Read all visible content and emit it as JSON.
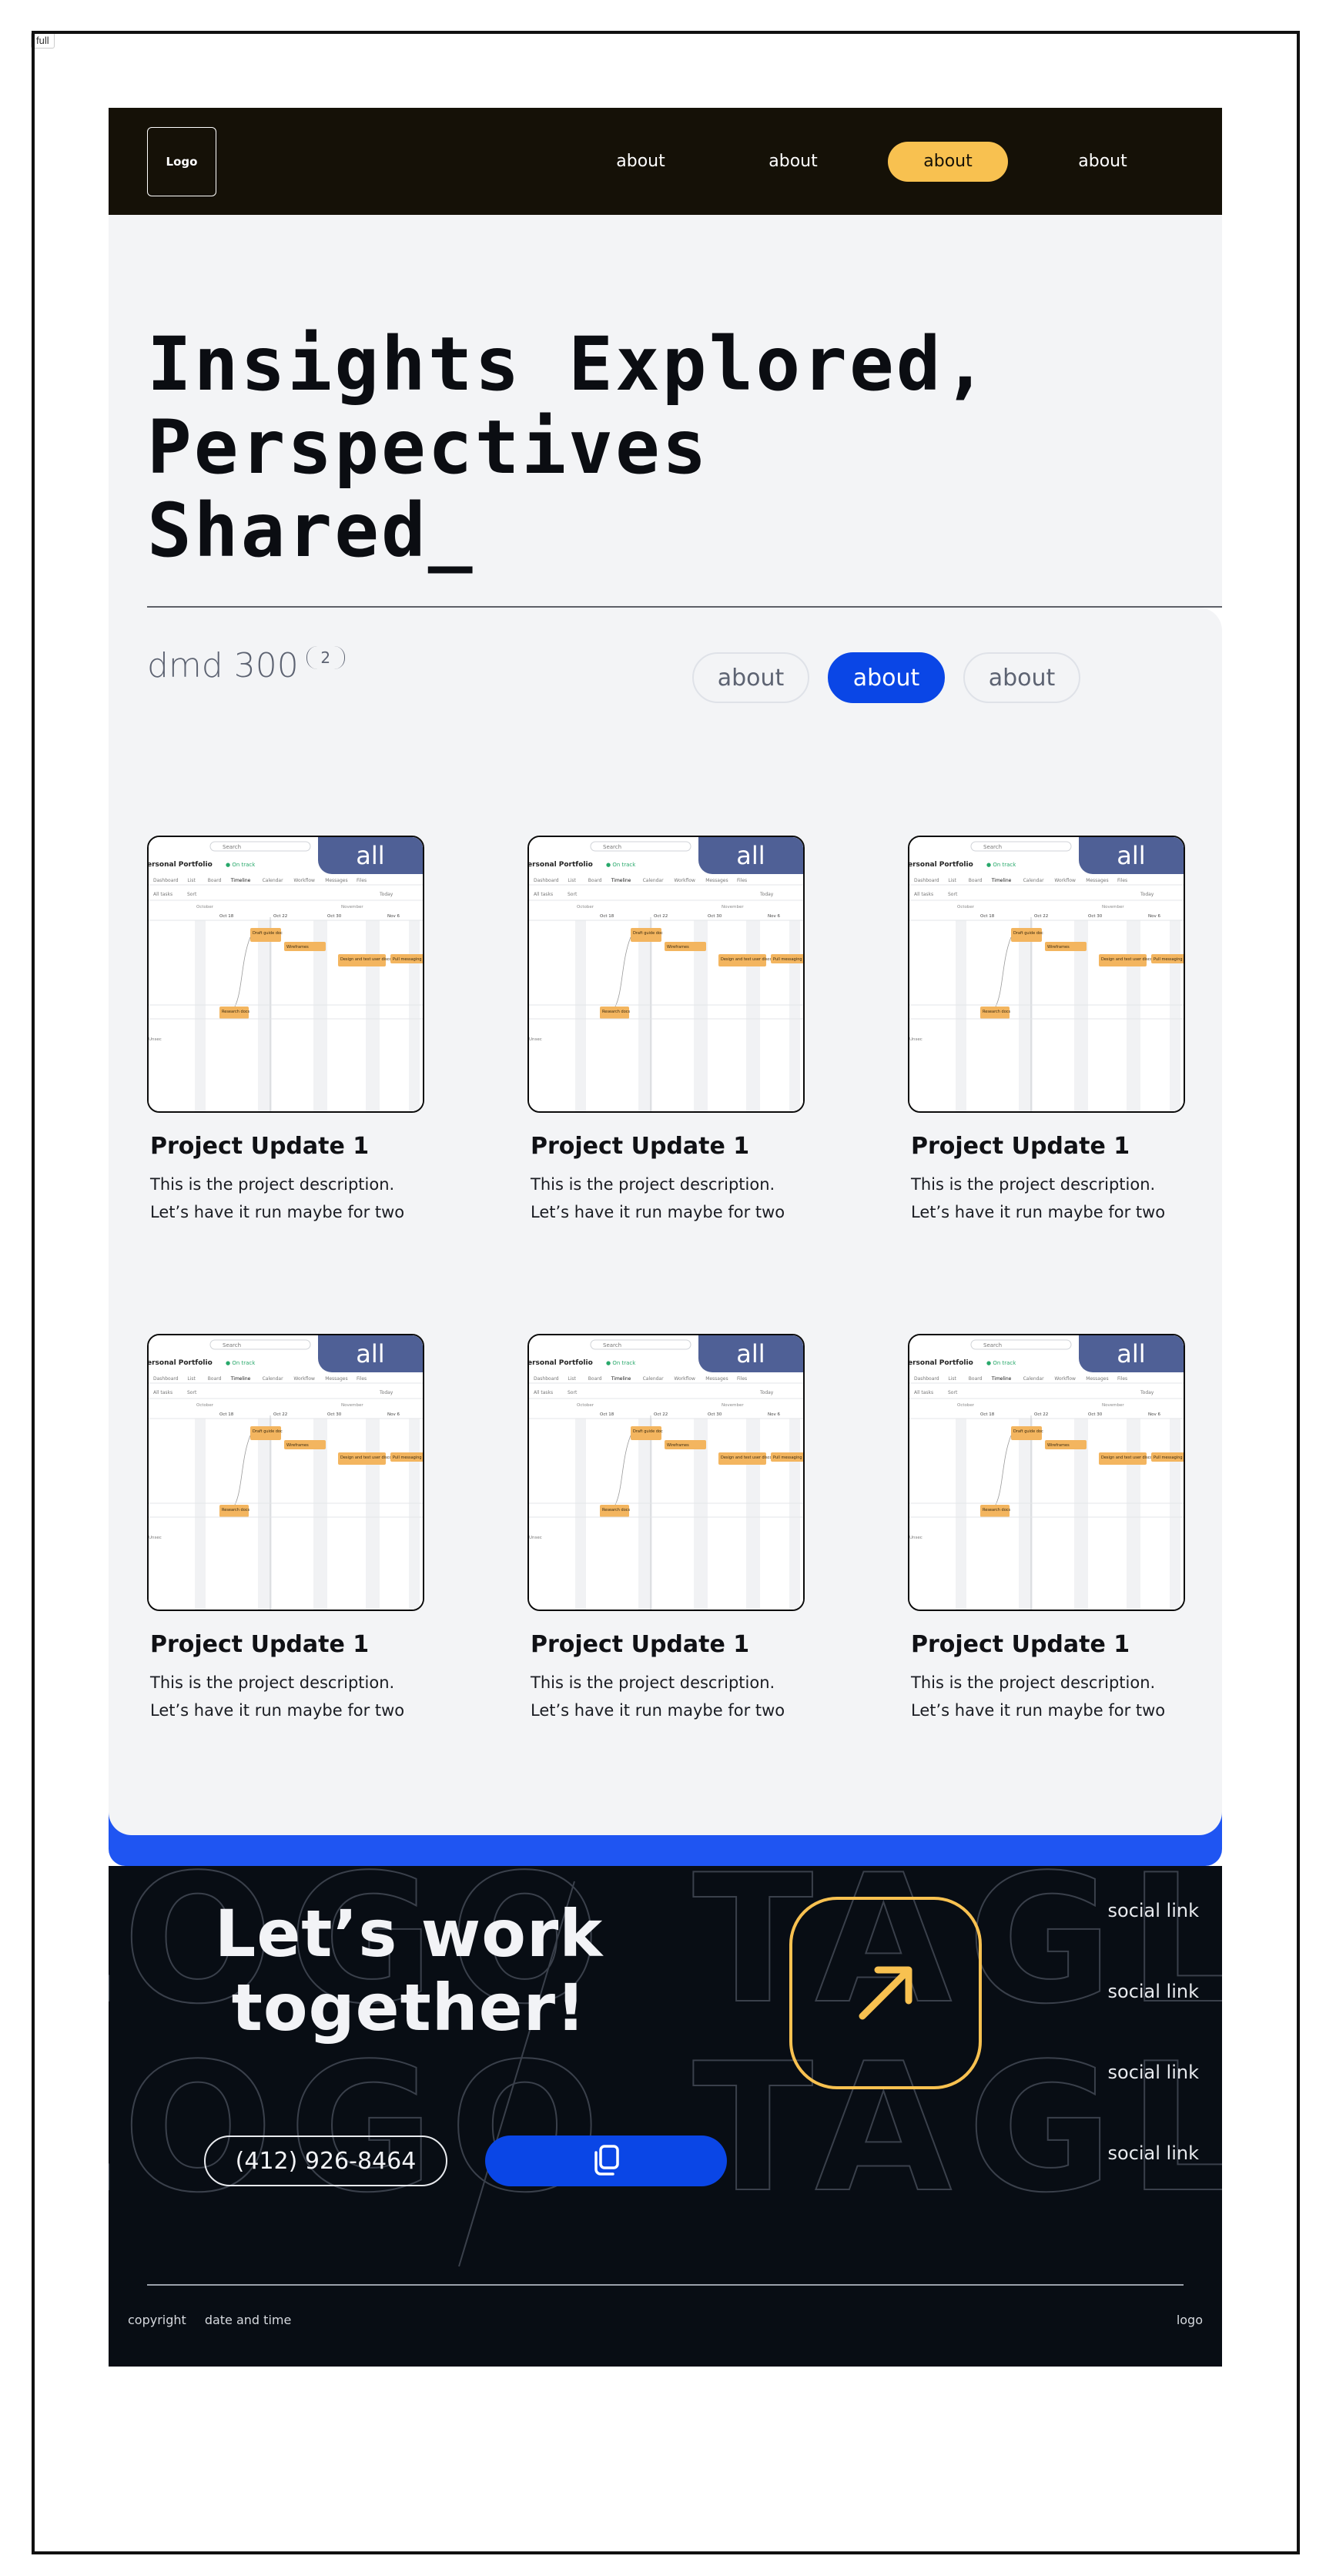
{
  "frame": {
    "label": "full"
  },
  "header": {
    "logo": "Logo",
    "nav": [
      {
        "label": "about",
        "active": false
      },
      {
        "label": "about",
        "active": false
      },
      {
        "label": "about",
        "active": true
      },
      {
        "label": "about",
        "active": false
      }
    ]
  },
  "hero": {
    "title": "Insights Explored,\nPerspectives\nShared_"
  },
  "projects": {
    "title": "dmd 300",
    "count": "2",
    "filters": [
      {
        "label": "about",
        "active": false
      },
      {
        "label": "about",
        "active": true
      },
      {
        "label": "about",
        "active": false
      }
    ],
    "cards": [
      {
        "badge": "all",
        "title": "Project Update 1",
        "description": "This is the project description. Let’s have it run maybe for two"
      },
      {
        "badge": "all",
        "title": "Project Update 1",
        "description": "This is the project description. Let’s have it run maybe for two"
      },
      {
        "badge": "all",
        "title": "Project Update 1",
        "description": "This is the project description. Let’s have it run maybe for two"
      },
      {
        "badge": "all",
        "title": "Project Update 1",
        "description": "This is the project description. Let’s have it run maybe for two"
      },
      {
        "badge": "all",
        "title": "Project Update 1",
        "description": "This is the project description. Let’s have it run maybe for two"
      },
      {
        "badge": "all",
        "title": "Project Update 1",
        "description": "This is the project description. Let’s have it run maybe for two"
      }
    ],
    "thumbnail": {
      "search": "Search",
      "portfolio": "ersonal Portfolio",
      "status": "On track",
      "tabs": [
        "Dashboard",
        "List",
        "Board",
        "Timeline",
        "Calendar",
        "Workflow",
        "Messages",
        "Files"
      ],
      "toolbar": [
        "All tasks",
        "Sort",
        "Today"
      ],
      "months": [
        "October",
        "November"
      ],
      "dates": [
        "Oct 18",
        "Oct 22",
        "Oct 30",
        "Nov 6"
      ],
      "tasks": [
        "Draft guide doc",
        "Wireframes",
        "Design and test user discovery",
        "Pull messaging",
        "Research docs"
      ],
      "side": "Unsec"
    }
  },
  "footer": {
    "cta": "Let’s work together!",
    "phone": "(412) 926-8464",
    "watermark": "LOGO TAGLINE",
    "social": [
      "social link",
      "social link",
      "social link",
      "social link"
    ],
    "copyright": "copyright",
    "datetime": "date and time",
    "logo": "logo"
  },
  "colors": {
    "header_bg": "#151107",
    "accent_yellow": "#f8c150",
    "accent_blue": "#0a46e6",
    "footer_bg": "#080d14",
    "badge_bg": "#4f6096",
    "panel_bg": "#f3f4f6"
  }
}
